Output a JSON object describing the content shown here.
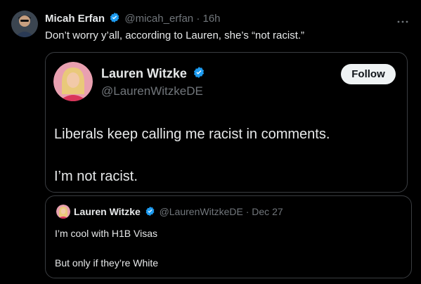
{
  "outer_tweet": {
    "author_name": "Micah Erfan",
    "handle": "@micah_erfan",
    "separator": "·",
    "time": "16h",
    "text": "Don’t worry y’all, according to Lauren, she’s “not racist.”",
    "more_icon": "more-dots-icon"
  },
  "quoted_tweet": {
    "author_name": "Lauren Witzke",
    "handle": "@LaurenWitzkeDE",
    "follow_label": "Follow",
    "line1": "Liberals keep calling me racist in comments.",
    "line2": "I’m not racist."
  },
  "nested_quote": {
    "author_name": "Lauren Witzke",
    "handle": "@LaurenWitzkeDE",
    "separator": "·",
    "date": "Dec 27",
    "line1": "I’m cool with H1B Visas",
    "line2": "But only if they’re White"
  },
  "colors": {
    "verified": "#1d9bf0",
    "background": "#000000",
    "muted": "#71767b"
  }
}
